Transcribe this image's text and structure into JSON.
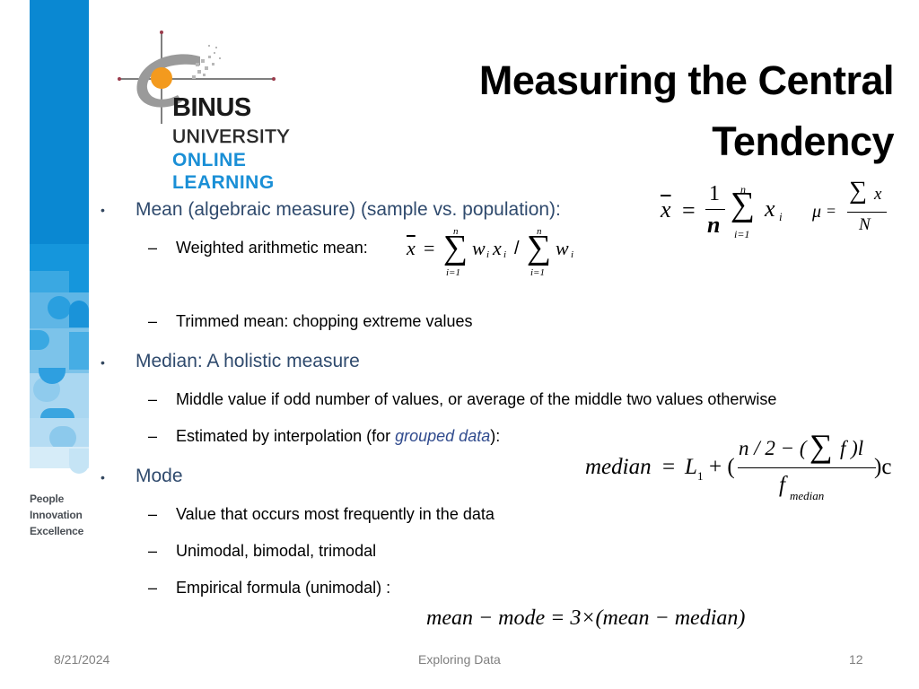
{
  "slide": {
    "title_line1": "Measuring the Central",
    "title_line2": "Tendency",
    "logo": {
      "line1": "BINUS",
      "line2": "UNIVERSITY",
      "line3": "ONLINE",
      "line4": "LEARNING"
    },
    "tagline": [
      "People",
      "Innovation",
      "Excellence"
    ],
    "bullets": [
      {
        "text": "Mean (algebraic measure) (sample vs. population):",
        "formula": "x̄ = (1/n) Σ_{i=1}^{n} x_i     μ = Σx / N",
        "subitems": [
          {
            "text": "Weighted arithmetic mean:",
            "formula": "x̄ = Σ_{i=1}^{n} w_i x_i / Σ_{i=1}^{n} w_i"
          },
          {
            "text": "Trimmed mean: chopping extreme values"
          }
        ]
      },
      {
        "text": "Median: A holistic measure",
        "subitems": [
          {
            "text": "Middle value if odd number of values, or average of the middle two values otherwise"
          },
          {
            "text_before": "Estimated by interpolation (for ",
            "text_italic": "grouped data",
            "text_after": "):",
            "formula": "median = L1 + ((n/2 − (Σf)l) / f_median) c"
          }
        ]
      },
      {
        "text": "Mode",
        "subitems": [
          {
            "text": "Value that occurs most frequently in the data"
          },
          {
            "text": "Unimodal, bimodal, trimodal"
          },
          {
            "text": "Empirical formula (unimodal) :",
            "formula": "mean − mode = 3 × (mean − median)"
          }
        ]
      }
    ],
    "bullet_symbol": "•",
    "dash_symbol": "–",
    "math": {
      "xbar": "x",
      "eq": "=",
      "one": "1",
      "n": "n",
      "sigma": "∑",
      "i_eq_1": "i=1",
      "x_i_base": "x",
      "sub_i": "i",
      "mu": "μ",
      "x": "x",
      "N": "N",
      "w": "w",
      "slash": "/",
      "median_lhs": "median",
      "L": "L",
      "sub1": "1",
      "plus_paren": "+ (",
      "num_left": "n / 2 − (",
      "num_right": "f )l",
      "close_c": ")c",
      "f": "f",
      "sub_median": "median",
      "empirical": "mean − mode = 3×(mean − median)"
    },
    "footer": {
      "date": "8/21/2024",
      "center": "Exploring Data",
      "page": "12"
    },
    "colors": {
      "stripe_blue": "#0a88d2",
      "heading_blue": "#2f4a6d",
      "logo_blue": "#1a8fd6",
      "logo_orange": "#f39a1e"
    }
  }
}
